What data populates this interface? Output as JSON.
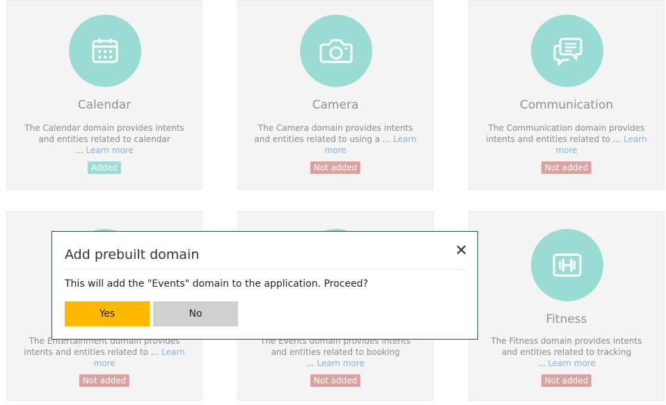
{
  "cards": [
    {
      "title": "Calendar",
      "desc_lines": [
        "The Calendar domain provides intents",
        "and entities related to calendar",
        "... "
      ],
      "learn": "Learn more",
      "status": "Added"
    },
    {
      "title": "Camera",
      "desc_lines": [
        "The Camera domain provides intents",
        "and entities related to using a ... "
      ],
      "learn": "Learn more",
      "status": "Not added"
    },
    {
      "title": "Communication",
      "desc_lines": [
        "The Communication domain provides",
        "intents and entities related to ... "
      ],
      "learn": "Learn more",
      "status": "Not added"
    },
    {
      "title": "",
      "desc_lines": [
        "The Entertainment domain provides",
        "intents and entities related to ... "
      ],
      "learn": "Learn more",
      "status": "Not added"
    },
    {
      "title": "",
      "desc_lines": [
        "The Events domain provides intents",
        "and entities related to booking",
        "... "
      ],
      "learn": "Learn more",
      "status": "Not added"
    },
    {
      "title": "Fitness",
      "desc_lines": [
        "The Fitness domain provides intents",
        "and entities related to tracking",
        "... "
      ],
      "learn": "Learn more",
      "status": "Not added"
    }
  ],
  "icons": [
    "calendar-icon",
    "camera-icon",
    "communication-icon",
    "entertainment-icon",
    "events-icon",
    "fitness-icon"
  ],
  "colors": {
    "icon_circle": "#9adcd3",
    "added_badge": "#9adcd3",
    "not_added_badge": "#dba0a0",
    "learn_more": "#82b4e0",
    "yes_button": "#ffb900",
    "no_button": "#d0d0d0"
  },
  "dialog": {
    "title": "Add prebuilt domain",
    "close": "✕",
    "message": "This will add the \"Events\" domain to the application. Proceed?",
    "yes": "Yes",
    "no": "No"
  }
}
